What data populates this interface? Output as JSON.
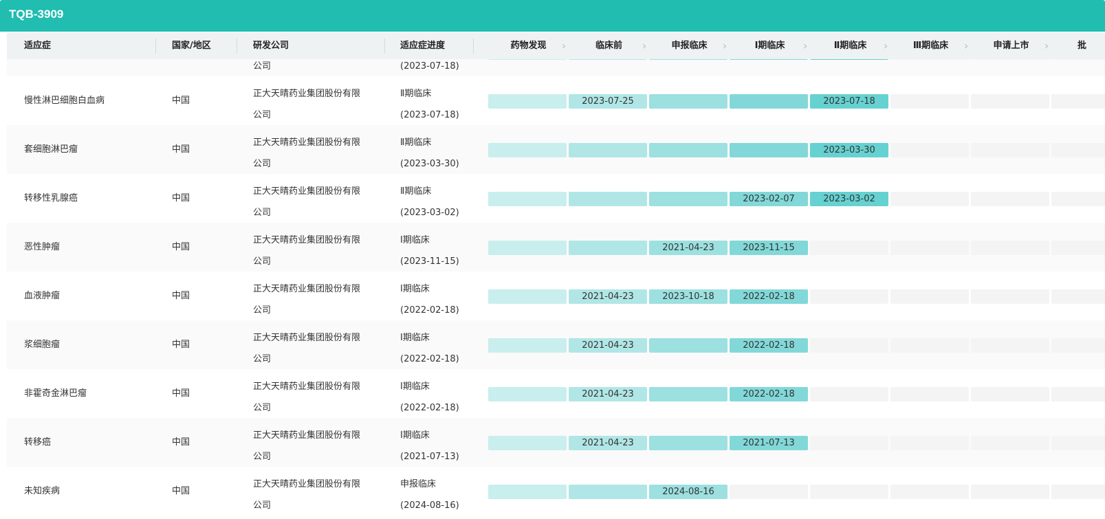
{
  "title": "TQB-3909",
  "headers": {
    "indication": "适应症",
    "country": "国家/地区",
    "company": "研发公司",
    "progress": "适应症进度"
  },
  "stages": [
    "药物发现",
    "临床前",
    "申报临床",
    "Ⅰ期临床",
    "Ⅱ期临床",
    "Ⅲ期临床",
    "申请上市",
    "批"
  ],
  "stage_colors": [
    "#c9eeee",
    "#b1e6e6",
    "#9ce0e0",
    "#82d8d8",
    "#66d1d1",
    "#66d1d1",
    "#66d1d1",
    "#66d1d1"
  ],
  "empty_color": "#f4f4f4",
  "partial_row": {
    "company_tail": "公司",
    "progress_date": "(2023-07-18)",
    "stages": [
      "",
      "",
      "",
      "",
      "",
      null,
      null,
      null
    ]
  },
  "rows": [
    {
      "indication": "慢性淋巴细胞白血病",
      "country": "中国",
      "company_l1": "正大天晴药业集团股份有限",
      "company_l2": "公司",
      "progress": "Ⅱ期临床",
      "progress_date": "(2023-07-18)",
      "stages": [
        "",
        "2023-07-25",
        "",
        "",
        "2023-07-18",
        null,
        null,
        null
      ]
    },
    {
      "indication": "套细胞淋巴瘤",
      "country": "中国",
      "company_l1": "正大天晴药业集团股份有限",
      "company_l2": "公司",
      "progress": "Ⅱ期临床",
      "progress_date": "(2023-03-30)",
      "stages": [
        "",
        "",
        "",
        "",
        "2023-03-30",
        null,
        null,
        null
      ]
    },
    {
      "indication": "转移性乳腺癌",
      "country": "中国",
      "company_l1": "正大天晴药业集团股份有限",
      "company_l2": "公司",
      "progress": "Ⅱ期临床",
      "progress_date": "(2023-03-02)",
      "stages": [
        "",
        "",
        "",
        "2023-02-07",
        "2023-03-02",
        null,
        null,
        null
      ]
    },
    {
      "indication": "恶性肿瘤",
      "country": "中国",
      "company_l1": "正大天晴药业集团股份有限",
      "company_l2": "公司",
      "progress": "Ⅰ期临床",
      "progress_date": "(2023-11-15)",
      "stages": [
        "",
        "",
        "2021-04-23",
        "2023-11-15",
        null,
        null,
        null,
        null
      ]
    },
    {
      "indication": "血液肿瘤",
      "country": "中国",
      "company_l1": "正大天晴药业集团股份有限",
      "company_l2": "公司",
      "progress": "Ⅰ期临床",
      "progress_date": "(2022-02-18)",
      "stages": [
        "",
        "2021-04-23",
        "2023-10-18",
        "2022-02-18",
        null,
        null,
        null,
        null
      ]
    },
    {
      "indication": "浆细胞瘤",
      "country": "中国",
      "company_l1": "正大天晴药业集团股份有限",
      "company_l2": "公司",
      "progress": "Ⅰ期临床",
      "progress_date": "(2022-02-18)",
      "stages": [
        "",
        "2021-04-23",
        "",
        "2022-02-18",
        null,
        null,
        null,
        null
      ]
    },
    {
      "indication": "非霍奇金淋巴瘤",
      "country": "中国",
      "company_l1": "正大天晴药业集团股份有限",
      "company_l2": "公司",
      "progress": "Ⅰ期临床",
      "progress_date": "(2022-02-18)",
      "stages": [
        "",
        "2021-04-23",
        "",
        "2022-02-18",
        null,
        null,
        null,
        null
      ]
    },
    {
      "indication": "转移癌",
      "country": "中国",
      "company_l1": "正大天晴药业集团股份有限",
      "company_l2": "公司",
      "progress": "Ⅰ期临床",
      "progress_date": "(2021-07-13)",
      "stages": [
        "",
        "2021-04-23",
        "",
        "2021-07-13",
        null,
        null,
        null,
        null
      ]
    },
    {
      "indication": "未知疾病",
      "country": "中国",
      "company_l1": "正大天晴药业集团股份有限",
      "company_l2": "公司",
      "progress": "申报临床",
      "progress_date": "(2024-08-16)",
      "stages": [
        "",
        "",
        "2024-08-16",
        null,
        null,
        null,
        null,
        null
      ]
    }
  ]
}
